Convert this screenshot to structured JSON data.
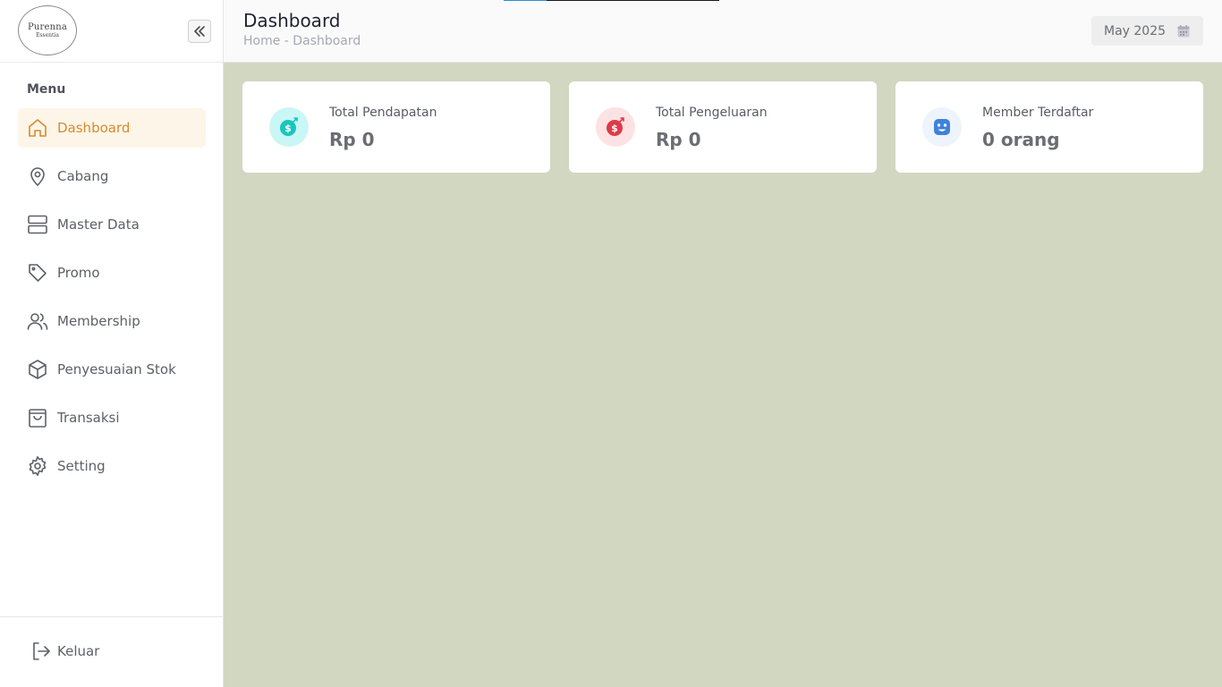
{
  "brand": {
    "logo_line1": "Purenna",
    "logo_line2": "Essentia"
  },
  "sidebar": {
    "menu_title": "Menu",
    "items": [
      {
        "label": "Dashboard",
        "icon": "home-icon",
        "active": true
      },
      {
        "label": "Cabang",
        "icon": "map-pin-icon"
      },
      {
        "label": "Master Data",
        "icon": "server-icon"
      },
      {
        "label": "Promo",
        "icon": "tag-icon"
      },
      {
        "label": "Membership",
        "icon": "users-icon"
      },
      {
        "label": "Penyesuaian Stok",
        "icon": "box-icon"
      },
      {
        "label": "Transaksi",
        "icon": "shopping-bag-icon"
      },
      {
        "label": "Setting",
        "icon": "gear-icon"
      }
    ],
    "logout_label": "Keluar"
  },
  "header": {
    "title": "Dashboard",
    "breadcrumb": "Home - Dashboard",
    "date_value": "May 2025"
  },
  "cards": [
    {
      "label": "Total Pendapatan",
      "value": "Rp 0",
      "icon": "income-dollar-icon",
      "color": "#1bc5bd",
      "bg": "#c9f7f5"
    },
    {
      "label": "Total Pengeluaran",
      "value": "Rp 0",
      "icon": "expense-dollar-icon",
      "color": "#dd3b48",
      "bg": "#fde2e4"
    },
    {
      "label": "Member Terdaftar",
      "value": "0 orang",
      "icon": "smile-icon",
      "color": "#3e82db",
      "bg": "#eef4fd"
    }
  ],
  "colors": {
    "accent": "#d68a2e",
    "active_bg": "#fdf5e8",
    "content_bg": "#d2d7c1"
  }
}
